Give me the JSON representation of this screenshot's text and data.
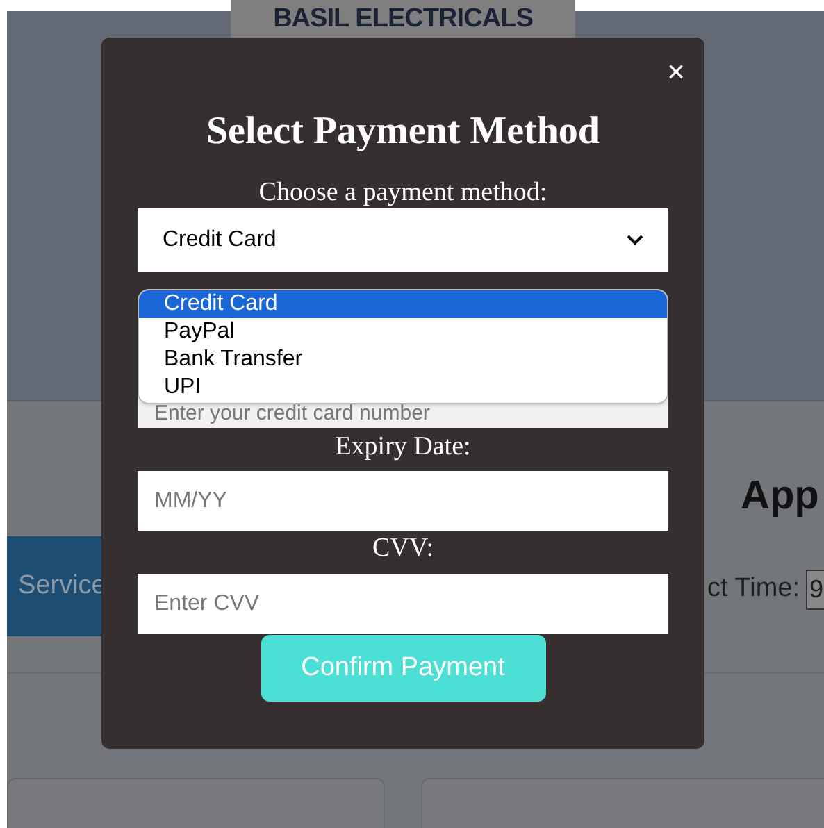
{
  "background": {
    "logo_text": "BASIL ELECTRICALS",
    "service_button": "Service",
    "heading": "App",
    "time_label": "ct Time:",
    "time_value": "9"
  },
  "modal": {
    "close": "×",
    "title": "Select Payment Method",
    "method_label": "Choose a payment method:",
    "method_value": "Credit Card",
    "options": [
      {
        "label": "Credit Card",
        "selected": true
      },
      {
        "label": "PayPal",
        "selected": false
      },
      {
        "label": "Bank Transfer",
        "selected": false
      },
      {
        "label": "UPI",
        "selected": false
      }
    ],
    "card_number_placeholder": "Enter your credit card number",
    "expiry_label": "Expiry Date:",
    "expiry_placeholder": "MM/YY",
    "cvv_label": "CVV:",
    "cvv_placeholder": "Enter CVV",
    "confirm_button": "Confirm Payment"
  }
}
